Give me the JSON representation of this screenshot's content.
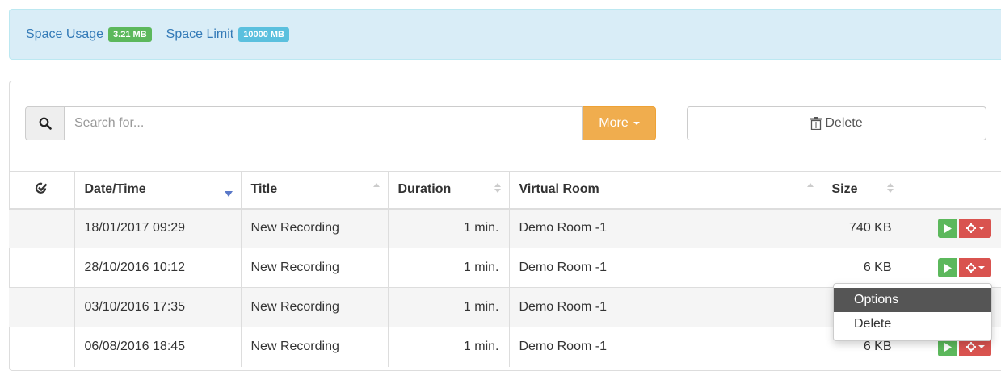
{
  "usage": {
    "space_usage_label": "Space Usage",
    "space_usage_value": "3.21 MB",
    "space_limit_label": "Space Limit",
    "space_limit_value": "10000 MB"
  },
  "toolbar": {
    "search_placeholder": "Search for...",
    "more_label": "More",
    "delete_label": "Delete"
  },
  "table": {
    "headers": {
      "date_time": "Date/Time",
      "title": "Title",
      "duration": "Duration",
      "virtual_room": "Virtual Room",
      "size": "Size"
    },
    "rows": [
      {
        "date": "18/01/2017 09:29",
        "title": "New Recording",
        "duration": "1 min.",
        "room": "Demo Room -1",
        "size": "740 KB"
      },
      {
        "date": "28/10/2016 10:12",
        "title": "New Recording",
        "duration": "1 min.",
        "room": "Demo Room -1",
        "size": "6 KB"
      },
      {
        "date": "03/10/2016 17:35",
        "title": "New Recording",
        "duration": "1 min.",
        "room": "Demo Room -1",
        "size": ""
      },
      {
        "date": "06/08/2016 18:45",
        "title": "New Recording",
        "duration": "1 min.",
        "room": "Demo Room -1",
        "size": "6 KB"
      }
    ]
  },
  "dropdown": {
    "items": [
      "Options",
      "Delete"
    ]
  },
  "colors": {
    "info_bg": "#d9edf7",
    "success": "#5cb85c",
    "info": "#5bc0de",
    "warning": "#f0ad4e",
    "danger": "#d9534f"
  }
}
